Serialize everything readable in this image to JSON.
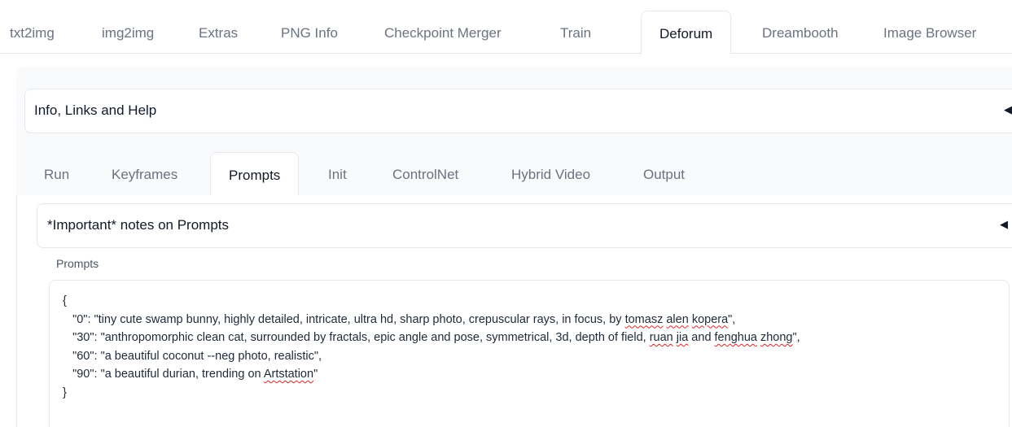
{
  "top_tabs": [
    "txt2img",
    "img2img",
    "Extras",
    "PNG Info",
    "Checkpoint Merger",
    "Train",
    "Deforum",
    "Dreambooth",
    "Image Browser"
  ],
  "top_active": "Deforum",
  "info_accordion": {
    "label": "Info, Links and Help",
    "caret": "◀"
  },
  "sub_tabs": [
    "Run",
    "Keyframes",
    "Prompts",
    "Init",
    "ControlNet",
    "Hybrid Video",
    "Output"
  ],
  "sub_active": "Prompts",
  "notes_accordion": {
    "label": "*Important* notes on Prompts",
    "caret": "◀"
  },
  "prompts": {
    "label": "Prompts",
    "open": "{",
    "line0_a": "   \"0\": \"tiny cute swamp bunny, highly detailed, intricate, ultra hd, sharp photo, crepuscular rays, in focus, by ",
    "line0_w1": "tomasz",
    "line0_s1": " ",
    "line0_w2": "alen",
    "line0_s2": " ",
    "line0_w3": "kopera",
    "line0_end": "\",",
    "line30_a": "   \"30\": \"anthropomorphic clean cat, surrounded by fractals, epic angle and pose, symmetrical, 3d, depth of field, ",
    "line30_w1": "ruan",
    "line30_s1": " ",
    "line30_w2": "jia",
    "line30_b": " and ",
    "line30_w3": "fenghua",
    "line30_s2": " ",
    "line30_w4": "zhong",
    "line30_end": "\",",
    "line60": "   \"60\": \"a beautiful coconut --neg photo, realistic\",",
    "line90_a": "   \"90\": \"a beautiful durian, trending on ",
    "line90_w1": "Artstation",
    "line90_end": "\"",
    "close": "}"
  }
}
